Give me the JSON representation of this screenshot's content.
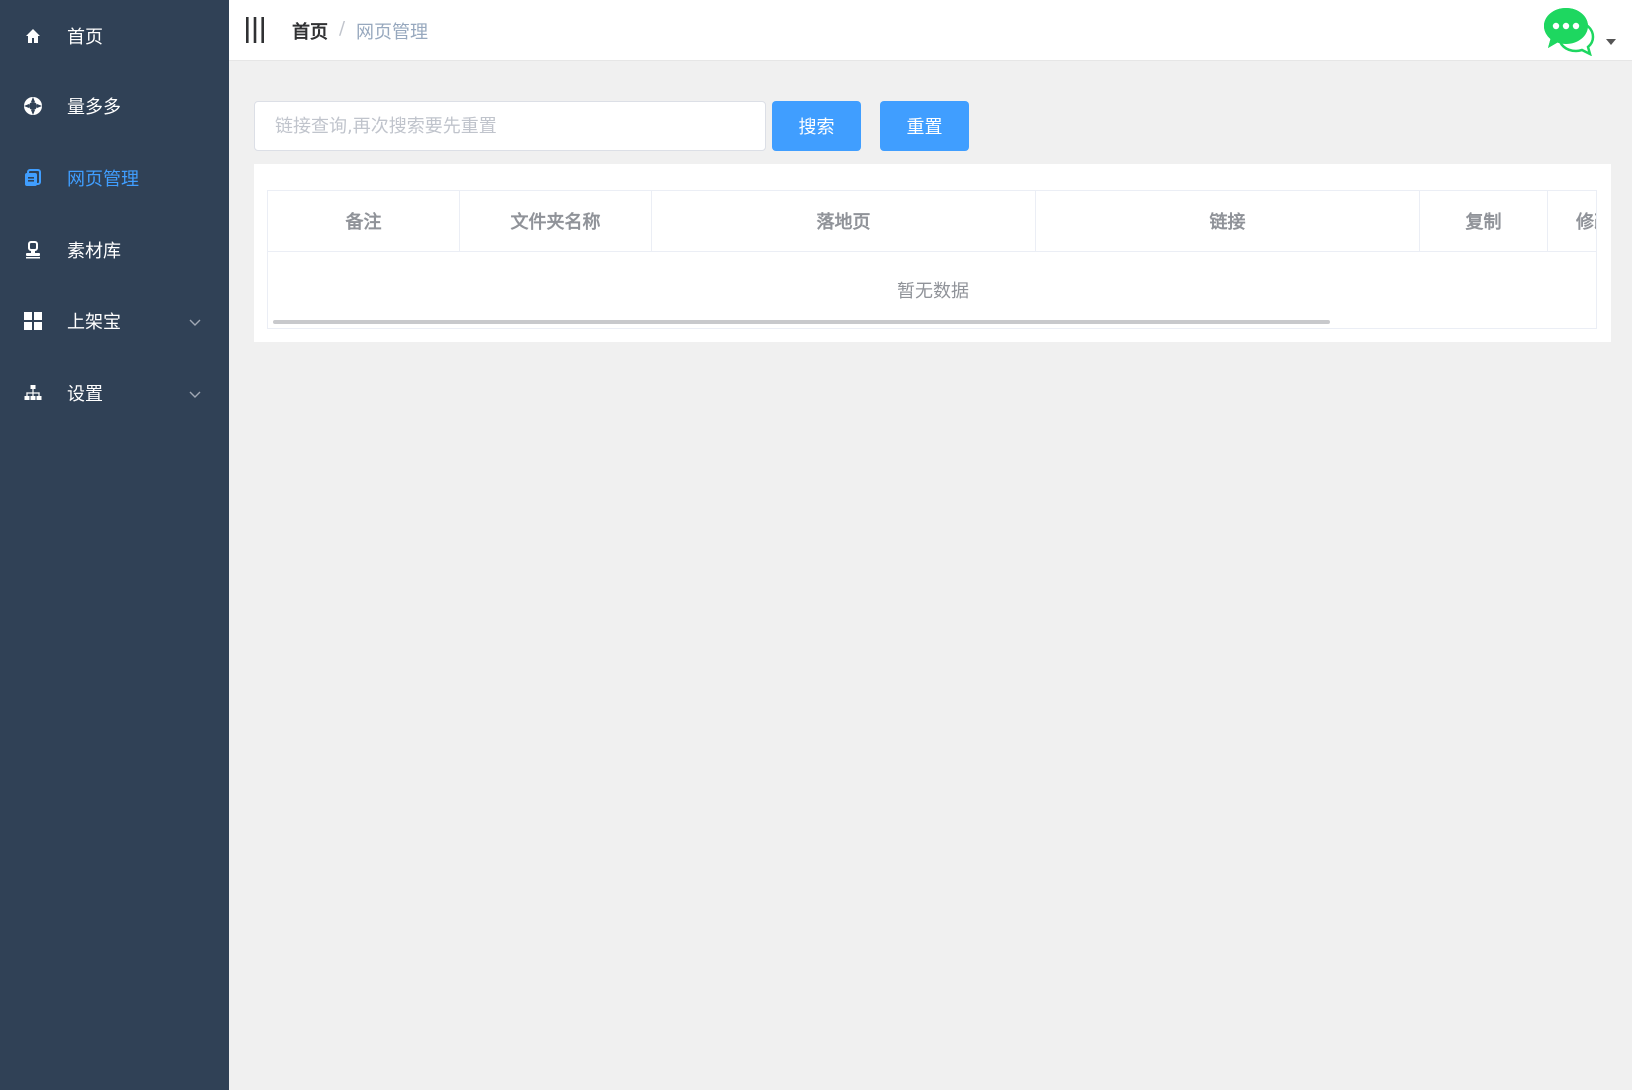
{
  "sidebar": {
    "bg_color": "#304156",
    "active_color": "#409eff",
    "items": [
      {
        "label": "首页",
        "icon": "home-icon"
      },
      {
        "label": "量多多",
        "icon": "lifebuoy-icon"
      },
      {
        "label": "网页管理",
        "icon": "document-icon",
        "active": true
      },
      {
        "label": "素材库",
        "icon": "stamp-icon"
      },
      {
        "label": "上架宝",
        "icon": "grid-icon",
        "expandable": true
      },
      {
        "label": "设置",
        "icon": "sitemap-icon",
        "expandable": true
      }
    ]
  },
  "header": {
    "menu_toggle_icon": "hamburger-icon",
    "breadcrumb": {
      "home": "首页",
      "separator": "/",
      "current": "网页管理"
    },
    "avatar_icon": "wechat-chat-icon"
  },
  "search": {
    "placeholder": "链接查询,再次搜索要先重置",
    "value": "",
    "search_label": "搜索",
    "reset_label": "重置",
    "button_color": "#409eff"
  },
  "table": {
    "columns": [
      "备注",
      "文件夹名称",
      "落地页",
      "链接",
      "复制",
      "修改"
    ],
    "rows": [],
    "empty_text": "暂无数据"
  }
}
